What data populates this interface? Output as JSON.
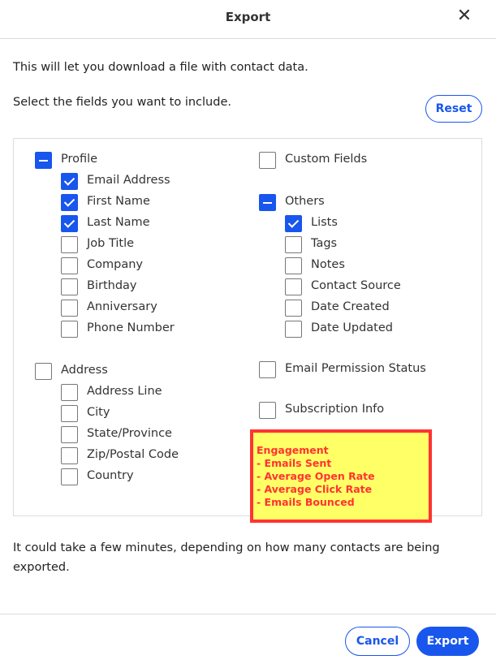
{
  "header": {
    "title": "Export",
    "close_icon": "close-icon"
  },
  "intro": "This will let you download a file with contact data.",
  "select_prompt": "Select the fields you want to include.",
  "reset_label": "Reset",
  "accent_color": "#1856ed",
  "fields": [
    {
      "label": "Profile",
      "state": "mixed",
      "level": 0,
      "col": 0,
      "row": 0
    },
    {
      "label": "Email Address",
      "state": "checked",
      "level": 1,
      "col": 0,
      "row": 1
    },
    {
      "label": "First Name",
      "state": "checked",
      "level": 1,
      "col": 0,
      "row": 2
    },
    {
      "label": "Last Name",
      "state": "checked",
      "level": 1,
      "col": 0,
      "row": 3
    },
    {
      "label": "Job Title",
      "state": "unchecked",
      "level": 1,
      "col": 0,
      "row": 4
    },
    {
      "label": "Company",
      "state": "unchecked",
      "level": 1,
      "col": 0,
      "row": 5
    },
    {
      "label": "Birthday",
      "state": "unchecked",
      "level": 1,
      "col": 0,
      "row": 6
    },
    {
      "label": "Anniversary",
      "state": "unchecked",
      "level": 1,
      "col": 0,
      "row": 7
    },
    {
      "label": "Phone Number",
      "state": "unchecked",
      "level": 1,
      "col": 0,
      "row": 8
    },
    {
      "label": "Address",
      "state": "unchecked",
      "level": 0,
      "col": 0,
      "row": 10
    },
    {
      "label": "Address Line",
      "state": "unchecked",
      "level": 1,
      "col": 0,
      "row": 11
    },
    {
      "label": "City",
      "state": "unchecked",
      "level": 1,
      "col": 0,
      "row": 12
    },
    {
      "label": "State/Province",
      "state": "unchecked",
      "level": 1,
      "col": 0,
      "row": 13
    },
    {
      "label": "Zip/Postal Code",
      "state": "unchecked",
      "level": 1,
      "col": 0,
      "row": 14
    },
    {
      "label": "Country",
      "state": "unchecked",
      "level": 1,
      "col": 0,
      "row": 15
    },
    {
      "label": "Custom Fields",
      "state": "unchecked",
      "level": 0,
      "col": 1,
      "row": 0
    },
    {
      "label": "Others",
      "state": "mixed",
      "level": 0,
      "col": 1,
      "row": 2
    },
    {
      "label": "Lists",
      "state": "checked",
      "level": 1,
      "col": 1,
      "row": 3
    },
    {
      "label": "Tags",
      "state": "unchecked",
      "level": 1,
      "col": 1,
      "row": 4
    },
    {
      "label": "Notes",
      "state": "unchecked",
      "level": 1,
      "col": 1,
      "row": 5
    },
    {
      "label": "Contact Source",
      "state": "unchecked",
      "level": 1,
      "col": 1,
      "row": 6
    },
    {
      "label": "Date Created",
      "state": "unchecked",
      "level": 1,
      "col": 1,
      "row": 7
    },
    {
      "label": "Date Updated",
      "state": "unchecked",
      "level": 1,
      "col": 1,
      "row": 8
    },
    {
      "label": "Email Permission Status",
      "state": "unchecked",
      "level": 0,
      "col": 1,
      "row": 9.92
    },
    {
      "label": "Subscription Info",
      "state": "unchecked",
      "level": 0,
      "col": 1,
      "row": 11.85
    }
  ],
  "annotation": {
    "lines": [
      "Engagement",
      "- Emails Sent",
      "- Average Open Rate",
      "- Average Click Rate",
      "- Emails Bounced"
    ]
  },
  "footer_note": "It could take a few minutes, depending on how many contacts are being exported.",
  "cancel_label": "Cancel",
  "export_label": "Export"
}
